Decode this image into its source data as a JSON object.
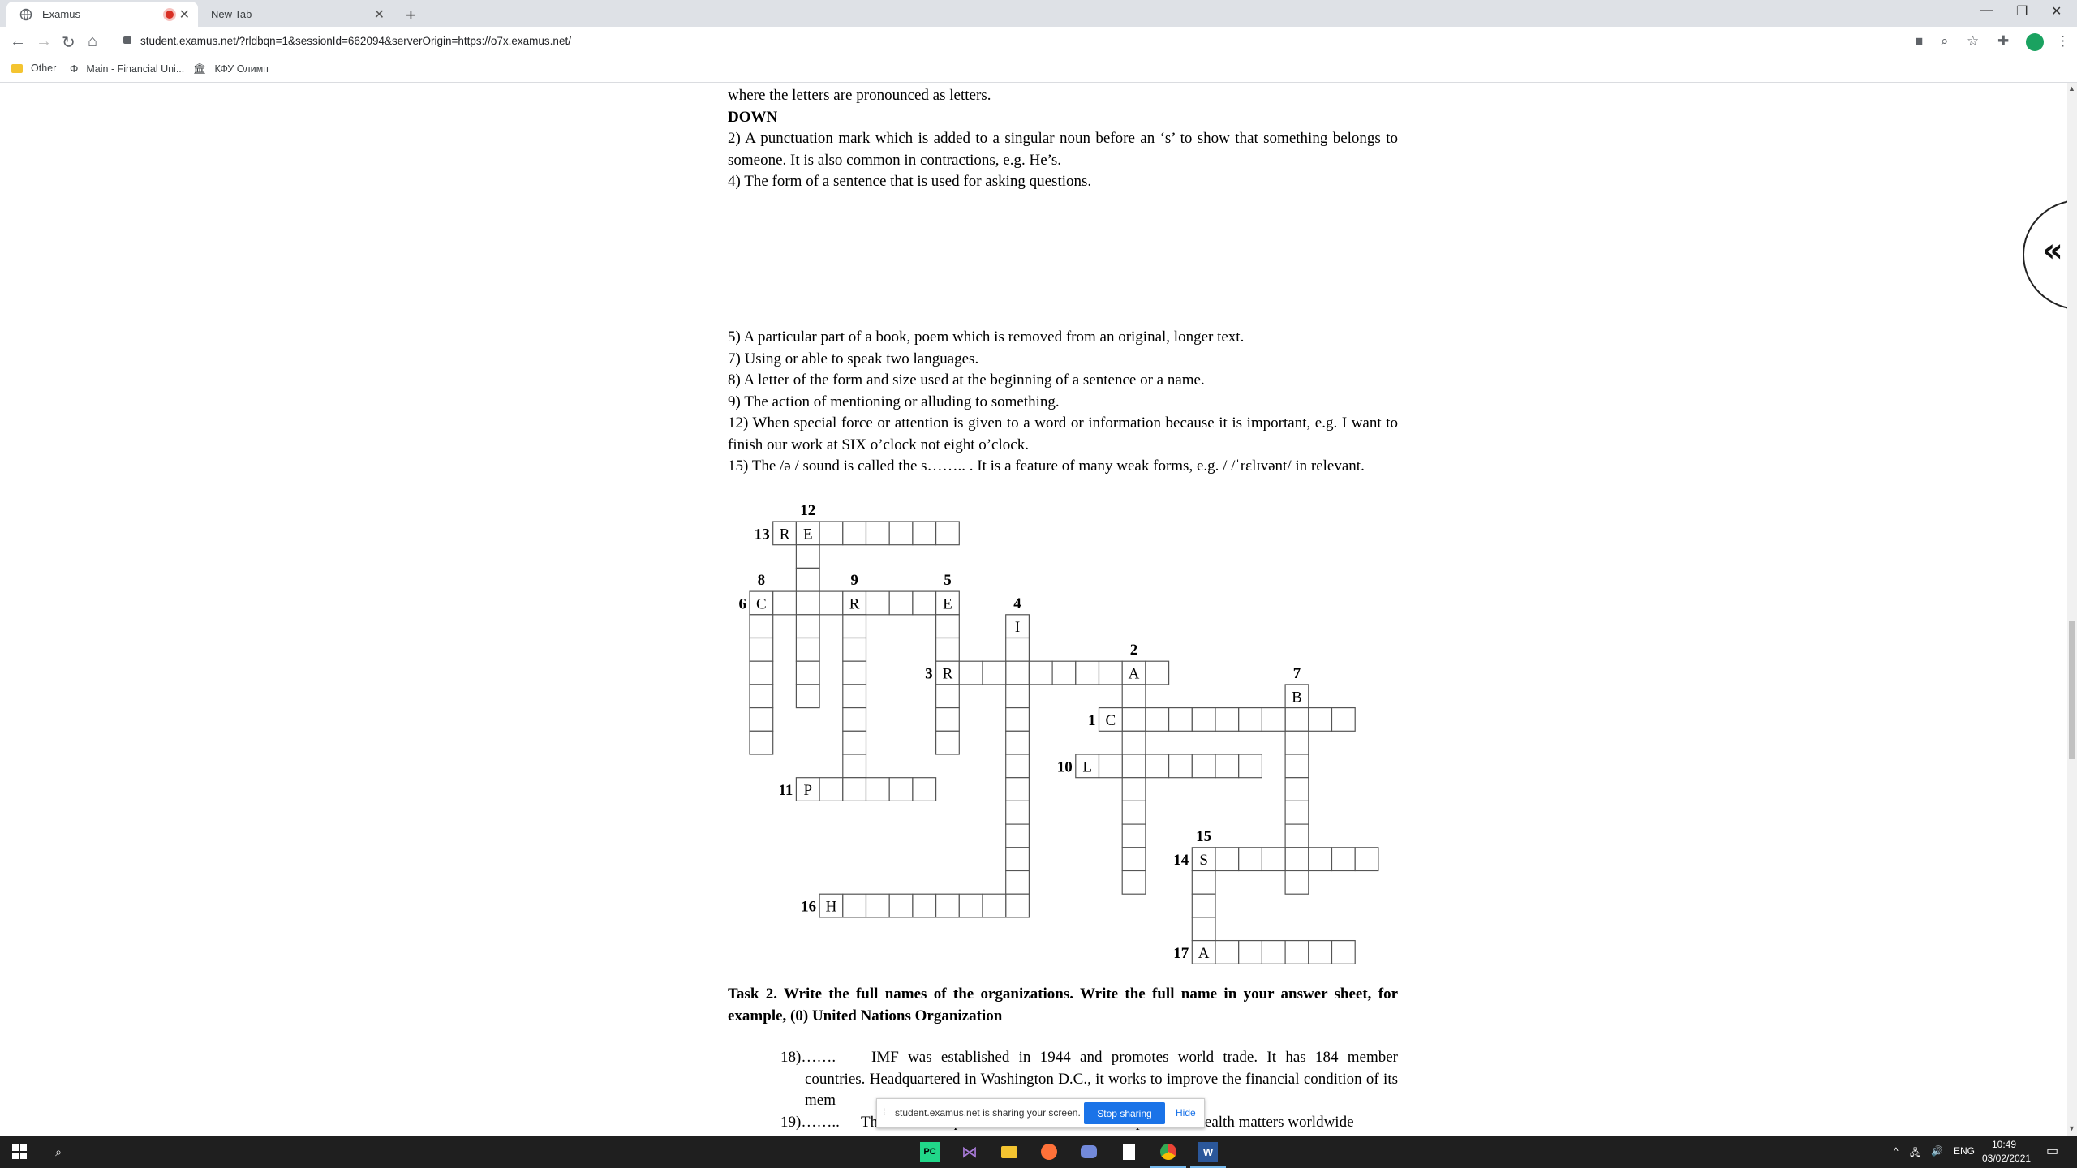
{
  "browser": {
    "tabs": [
      {
        "title": "Examus",
        "icon": "globe-icon"
      },
      {
        "title": "New Tab"
      }
    ],
    "url": "student.examus.net/?rldbqn=1&sessionId=662094&serverOrigin=https://o7x.examus.net/",
    "bookmarks": [
      "Other",
      "Main - Financial Uni...",
      "КФУ Олимп"
    ]
  },
  "doc": {
    "top_partial": "where the letters are pronounced as letters.",
    "down_heading": "DOWN",
    "down_clues": [
      "2) A punctuation mark which is added to a singular noun before an ‘s’ to show that something belongs to someone. It is also common in contractions, e.g. He’s.",
      "4) The form of a sentence that is used for asking questions."
    ],
    "clues_block2": [
      "5) A particular part of a book, poem which is removed from an original, longer text.",
      "7) Using or able to speak two languages.",
      "8) A letter of the form and size used at the beginning of a sentence or a name.",
      "9) The action of mentioning or alluding to something.",
      "12) When special force or attention is given to a word or information because it is important, e.g. I want to finish our work at SIX o’clock not eight  o’clock.",
      "15) The /ə / sound is called the s…….. . It is a feature of many weak forms, e.g. / /ˈrɛlɪvənt/ in relevant."
    ],
    "task2_heading": "Task 2. Write the full names of the organizations. Write the full name in your answer sheet, for example, (0) United Nations Organization",
    "q18_num": "18)…….",
    "q18_text": "IMF was established in 1944 and promotes world trade. It has 184 member countries. Headquartered in Washington D.C., it works to improve the financial condition of its mem",
    "q19_num": "19)……..",
    "q19_text": "The WHO is a part of the United Nations. It promotes health matters worldwide"
  },
  "crossword": {
    "words": [
      {
        "num": "13",
        "dir": "across",
        "row": 0,
        "col": 1,
        "len": 8,
        "letters": {
          "0": "R",
          "1": "E"
        }
      },
      {
        "num": "12",
        "dir": "down",
        "row": 0,
        "col": 2,
        "len": 8,
        "letters": {}
      },
      {
        "num": "6",
        "dir": "across",
        "row": 3,
        "col": 0,
        "len": 9,
        "letters": {
          "0": "C",
          "4": "R",
          "8": "E"
        }
      },
      {
        "num": "8",
        "dir": "down",
        "row": 3,
        "col": 0,
        "len": 7,
        "letters": {}
      },
      {
        "num": "9",
        "dir": "down",
        "row": 3,
        "col": 4,
        "len": 8,
        "letters": {}
      },
      {
        "num": "5",
        "dir": "down",
        "row": 3,
        "col": 8,
        "len": 7,
        "letters": {}
      },
      {
        "num": "4",
        "dir": "down",
        "row": 4,
        "col": 11,
        "len": 13,
        "letters": {
          "0": "I"
        }
      },
      {
        "num": "3",
        "dir": "across",
        "row": 6,
        "col": 8,
        "len": 10,
        "letters": {
          "0": "R",
          "8": "A"
        }
      },
      {
        "num": "2",
        "dir": "down",
        "row": 6,
        "col": 16,
        "len": 10,
        "letters": {}
      },
      {
        "num": "7",
        "dir": "down",
        "row": 7,
        "col": 23,
        "len": 9,
        "letters": {
          "0": "B"
        }
      },
      {
        "num": "1",
        "dir": "across",
        "row": 8,
        "col": 15,
        "len": 11,
        "letters": {
          "0": "C"
        }
      },
      {
        "num": "10",
        "dir": "across",
        "row": 10,
        "col": 14,
        "len": 8,
        "letters": {
          "0": "L"
        }
      },
      {
        "num": "11",
        "dir": "across",
        "row": 11,
        "col": 2,
        "len": 6,
        "letters": {
          "0": "P"
        }
      },
      {
        "num": "15",
        "dir": "down",
        "row": 14,
        "col": 19,
        "len": 5,
        "letters": {}
      },
      {
        "num": "14",
        "dir": "across",
        "row": 14,
        "col": 19,
        "len": 8,
        "letters": {
          "0": "S"
        }
      },
      {
        "num": "16",
        "dir": "across",
        "row": 16,
        "col": 3,
        "len": 9,
        "letters": {
          "0": "H"
        }
      },
      {
        "num": "17",
        "dir": "across",
        "row": 18,
        "col": 19,
        "len": 7,
        "letters": {
          "0": "A"
        }
      }
    ]
  },
  "share_bar": {
    "text": "student.examus.net is sharing your screen.",
    "stop": "Stop sharing",
    "hide": "Hide"
  },
  "taskbar": {
    "lang": "ENG",
    "time": "10:49",
    "date": "03/02/2021"
  },
  "sidebar_toggle": "«"
}
